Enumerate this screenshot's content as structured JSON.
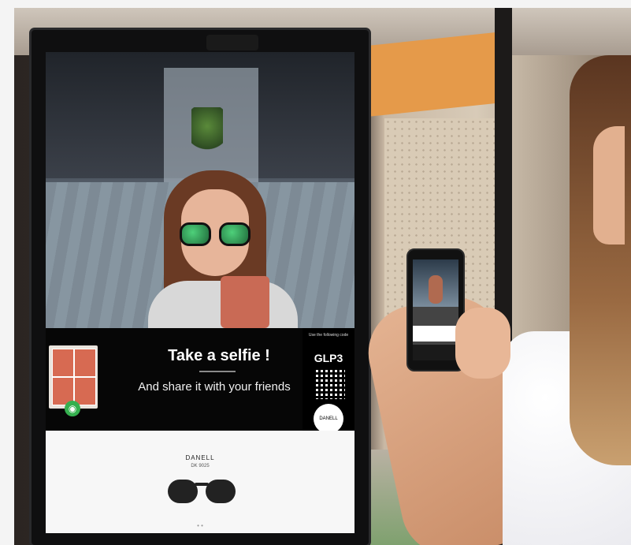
{
  "kiosk": {
    "cta_title": "Take a selfie !",
    "cta_subtitle": "And share it with your friends",
    "code_hint": "Use the following code",
    "code_value": "GLP3",
    "logo_text": "DANELL",
    "product": {
      "brand": "DANELL",
      "model": "DK 9025"
    }
  },
  "colors": {
    "accent_green": "#35b04f",
    "lens_green": "#3fbf6a"
  },
  "icons": {
    "camera": "camera-icon",
    "qr": "qr-code-icon"
  }
}
